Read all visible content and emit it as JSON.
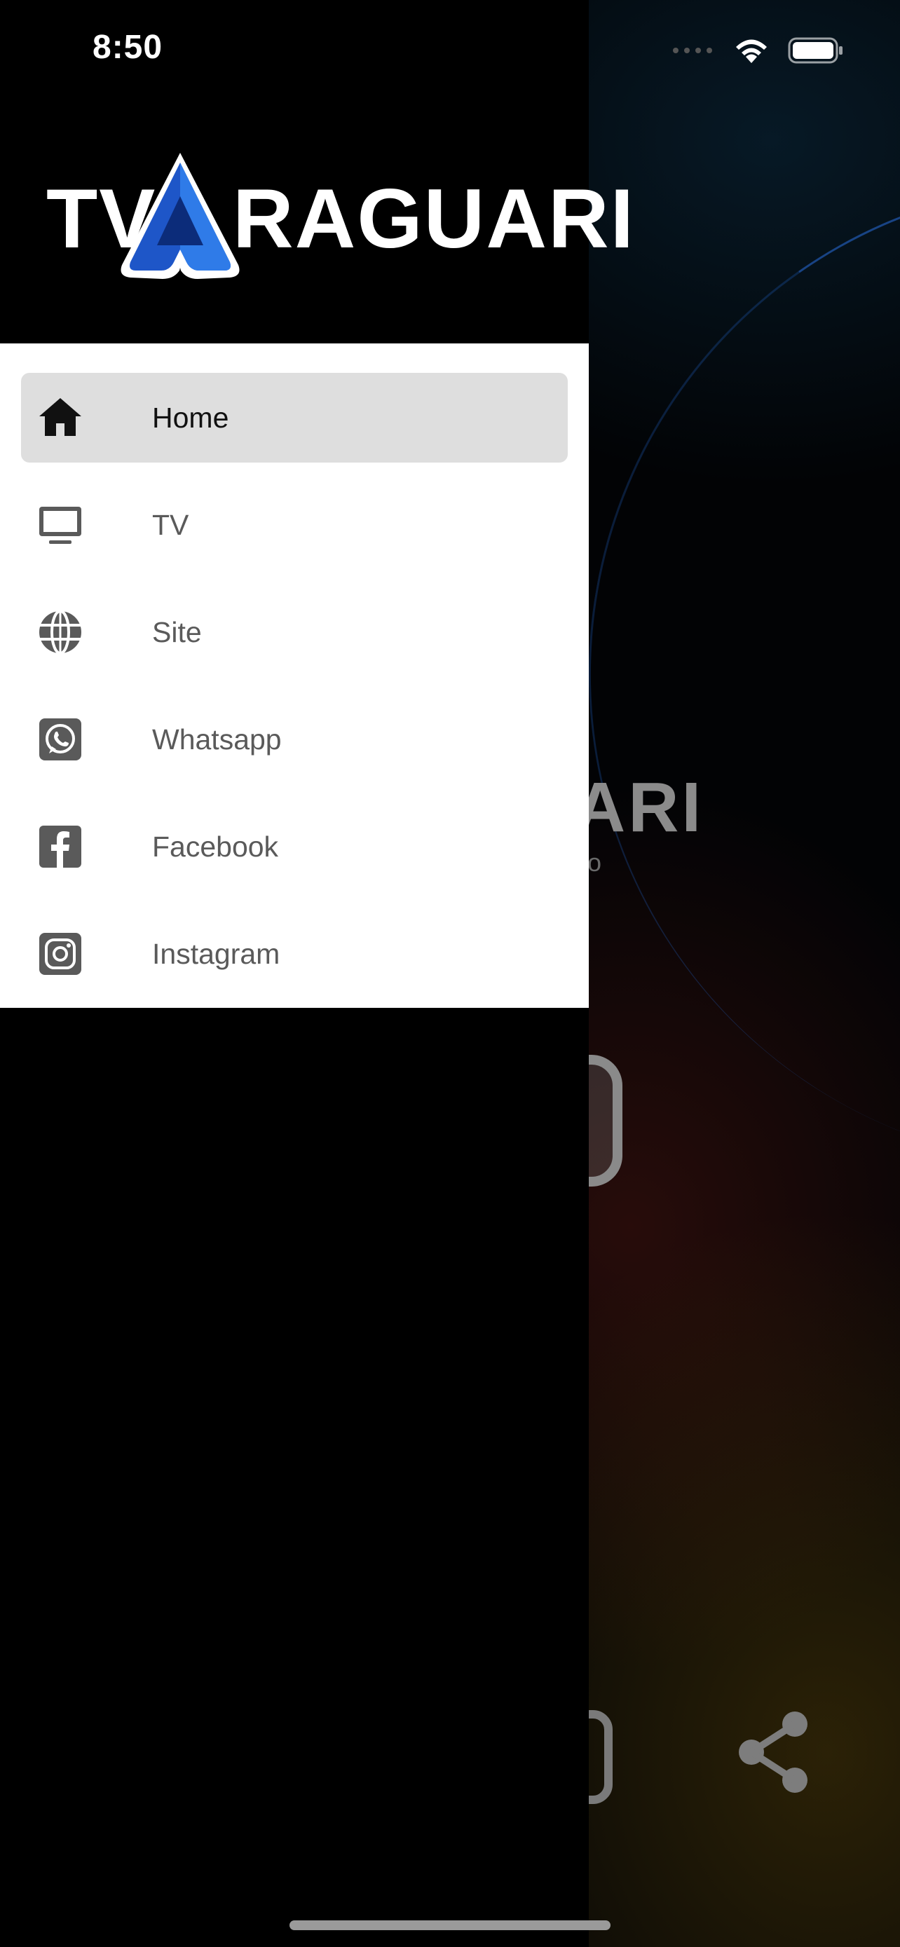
{
  "status_bar": {
    "time": "8:50"
  },
  "background": {
    "logo_text": "ARI",
    "logo_sub": "lo"
  },
  "drawer": {
    "logo": {
      "prefix": "TV",
      "suffix": "RAGUARI"
    },
    "items": [
      {
        "label": "Home",
        "icon": "home-icon",
        "active": true
      },
      {
        "label": "TV",
        "icon": "tv-icon",
        "active": false
      },
      {
        "label": "Site",
        "icon": "globe-icon",
        "active": false
      },
      {
        "label": "Whatsapp",
        "icon": "whatsapp-icon",
        "active": false
      },
      {
        "label": "Facebook",
        "icon": "facebook-icon",
        "active": false
      },
      {
        "label": "Instagram",
        "icon": "instagram-icon",
        "active": false
      }
    ]
  },
  "colors": {
    "drawer_header": "#000000",
    "menu_background": "#ffffff",
    "active_item": "#dedede",
    "icon_gray": "#5a5a5a",
    "logo_blue": "#1e56c8"
  }
}
